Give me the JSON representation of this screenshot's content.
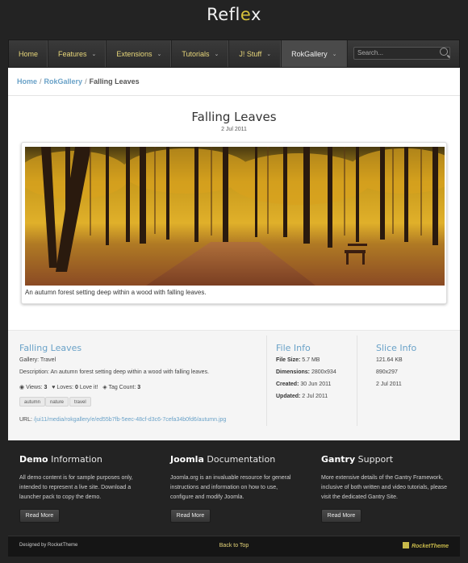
{
  "site": {
    "logo_main": "Refl",
    "logo_accent": "e",
    "logo_end": "x"
  },
  "nav": {
    "items": [
      {
        "label": "Home",
        "dropdown": false
      },
      {
        "label": "Features",
        "dropdown": true
      },
      {
        "label": "Extensions",
        "dropdown": true
      },
      {
        "label": "Tutorials",
        "dropdown": true
      },
      {
        "label": "J! Stuff",
        "dropdown": true
      },
      {
        "label": "RokGallery",
        "dropdown": true,
        "active": true
      }
    ],
    "search_placeholder": "Search..."
  },
  "breadcrumb": {
    "home": "Home",
    "section": "RokGallery",
    "current": "Falling Leaves",
    "sep": "/"
  },
  "article": {
    "title": "Falling Leaves",
    "date": "2 Jul 2011",
    "caption": "An autumn forest setting deep within a wood with falling leaves."
  },
  "details": {
    "title": "Falling Leaves",
    "gallery": "Gallery: Travel",
    "description": "Description: An autumn forest setting deep within a wood with falling leaves.",
    "views_label": "Views:",
    "views": "3",
    "loves_label": "Loves:",
    "loves": "0",
    "love_it": "Love it!",
    "tagcount_label": "Tag Count:",
    "tagcount": "3",
    "tags": [
      "autumn",
      "nature",
      "travel"
    ],
    "url_label": "URL:",
    "url": "/jui11/media/rokgallery/e/ed55b7fb-5eec-48cf-d3c6-7cefa34b0fd6/autumn.jpg"
  },
  "file_info": {
    "title": "File Info",
    "size_label": "File Size:",
    "size": "5.7 MB",
    "dims_label": "Dimensions:",
    "dims": "2800x934",
    "created_label": "Created:",
    "created": "30 Jun 2011",
    "updated_label": "Updated:",
    "updated": "2 Jul 2011"
  },
  "slice_info": {
    "title": "Slice Info",
    "size": "121.64 KB",
    "dims": "890x297",
    "date": "2 Jul 2011"
  },
  "footer": {
    "cols": [
      {
        "title_bold": "Demo",
        "title_rest": " Information",
        "text": "All demo content is for sample purposes only, intended to represent a live site. Download a launcher pack to copy the demo.",
        "button": "Read More"
      },
      {
        "title_bold": "Joomla",
        "title_rest": " Documentation",
        "text": "Joomla.org is an invaluable resource for general instructions and information on how to use, configure and modify Joomla.",
        "button": "Read More"
      },
      {
        "title_bold": "Gantry",
        "title_rest": " Support",
        "text": "More extensive details of the Gantry Framework, inclusive of both written and video tutorials, please visit the dedicated Gantry Site.",
        "button": "Read More"
      }
    ],
    "designed_by": "Designed by RocketTheme",
    "back_to_top": "Back to Top",
    "brand": "RocketTheme"
  },
  "colors": {
    "accent_blue": "#6aa2c8",
    "nav_text": "#e8d77a",
    "background": "#232323"
  }
}
